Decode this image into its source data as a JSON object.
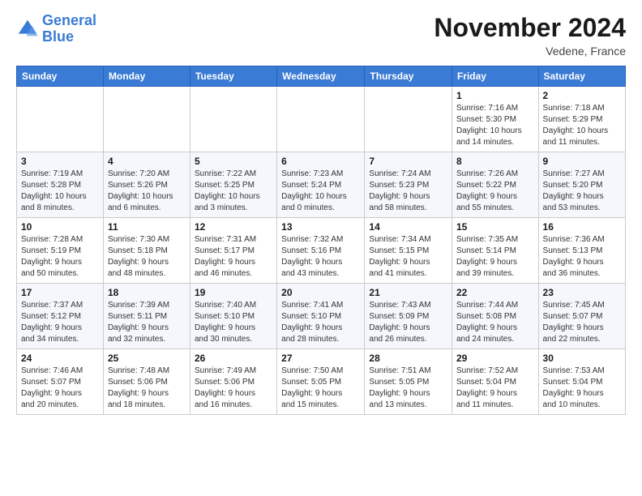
{
  "header": {
    "logo_line1": "General",
    "logo_line2": "Blue",
    "main_title": "November 2024",
    "subtitle": "Vedene, France"
  },
  "weekdays": [
    "Sunday",
    "Monday",
    "Tuesday",
    "Wednesday",
    "Thursday",
    "Friday",
    "Saturday"
  ],
  "weeks": [
    [
      {
        "day": "",
        "info": ""
      },
      {
        "day": "",
        "info": ""
      },
      {
        "day": "",
        "info": ""
      },
      {
        "day": "",
        "info": ""
      },
      {
        "day": "",
        "info": ""
      },
      {
        "day": "1",
        "info": "Sunrise: 7:16 AM\nSunset: 5:30 PM\nDaylight: 10 hours\nand 14 minutes."
      },
      {
        "day": "2",
        "info": "Sunrise: 7:18 AM\nSunset: 5:29 PM\nDaylight: 10 hours\nand 11 minutes."
      }
    ],
    [
      {
        "day": "3",
        "info": "Sunrise: 7:19 AM\nSunset: 5:28 PM\nDaylight: 10 hours\nand 8 minutes."
      },
      {
        "day": "4",
        "info": "Sunrise: 7:20 AM\nSunset: 5:26 PM\nDaylight: 10 hours\nand 6 minutes."
      },
      {
        "day": "5",
        "info": "Sunrise: 7:22 AM\nSunset: 5:25 PM\nDaylight: 10 hours\nand 3 minutes."
      },
      {
        "day": "6",
        "info": "Sunrise: 7:23 AM\nSunset: 5:24 PM\nDaylight: 10 hours\nand 0 minutes."
      },
      {
        "day": "7",
        "info": "Sunrise: 7:24 AM\nSunset: 5:23 PM\nDaylight: 9 hours\nand 58 minutes."
      },
      {
        "day": "8",
        "info": "Sunrise: 7:26 AM\nSunset: 5:22 PM\nDaylight: 9 hours\nand 55 minutes."
      },
      {
        "day": "9",
        "info": "Sunrise: 7:27 AM\nSunset: 5:20 PM\nDaylight: 9 hours\nand 53 minutes."
      }
    ],
    [
      {
        "day": "10",
        "info": "Sunrise: 7:28 AM\nSunset: 5:19 PM\nDaylight: 9 hours\nand 50 minutes."
      },
      {
        "day": "11",
        "info": "Sunrise: 7:30 AM\nSunset: 5:18 PM\nDaylight: 9 hours\nand 48 minutes."
      },
      {
        "day": "12",
        "info": "Sunrise: 7:31 AM\nSunset: 5:17 PM\nDaylight: 9 hours\nand 46 minutes."
      },
      {
        "day": "13",
        "info": "Sunrise: 7:32 AM\nSunset: 5:16 PM\nDaylight: 9 hours\nand 43 minutes."
      },
      {
        "day": "14",
        "info": "Sunrise: 7:34 AM\nSunset: 5:15 PM\nDaylight: 9 hours\nand 41 minutes."
      },
      {
        "day": "15",
        "info": "Sunrise: 7:35 AM\nSunset: 5:14 PM\nDaylight: 9 hours\nand 39 minutes."
      },
      {
        "day": "16",
        "info": "Sunrise: 7:36 AM\nSunset: 5:13 PM\nDaylight: 9 hours\nand 36 minutes."
      }
    ],
    [
      {
        "day": "17",
        "info": "Sunrise: 7:37 AM\nSunset: 5:12 PM\nDaylight: 9 hours\nand 34 minutes."
      },
      {
        "day": "18",
        "info": "Sunrise: 7:39 AM\nSunset: 5:11 PM\nDaylight: 9 hours\nand 32 minutes."
      },
      {
        "day": "19",
        "info": "Sunrise: 7:40 AM\nSunset: 5:10 PM\nDaylight: 9 hours\nand 30 minutes."
      },
      {
        "day": "20",
        "info": "Sunrise: 7:41 AM\nSunset: 5:10 PM\nDaylight: 9 hours\nand 28 minutes."
      },
      {
        "day": "21",
        "info": "Sunrise: 7:43 AM\nSunset: 5:09 PM\nDaylight: 9 hours\nand 26 minutes."
      },
      {
        "day": "22",
        "info": "Sunrise: 7:44 AM\nSunset: 5:08 PM\nDaylight: 9 hours\nand 24 minutes."
      },
      {
        "day": "23",
        "info": "Sunrise: 7:45 AM\nSunset: 5:07 PM\nDaylight: 9 hours\nand 22 minutes."
      }
    ],
    [
      {
        "day": "24",
        "info": "Sunrise: 7:46 AM\nSunset: 5:07 PM\nDaylight: 9 hours\nand 20 minutes."
      },
      {
        "day": "25",
        "info": "Sunrise: 7:48 AM\nSunset: 5:06 PM\nDaylight: 9 hours\nand 18 minutes."
      },
      {
        "day": "26",
        "info": "Sunrise: 7:49 AM\nSunset: 5:06 PM\nDaylight: 9 hours\nand 16 minutes."
      },
      {
        "day": "27",
        "info": "Sunrise: 7:50 AM\nSunset: 5:05 PM\nDaylight: 9 hours\nand 15 minutes."
      },
      {
        "day": "28",
        "info": "Sunrise: 7:51 AM\nSunset: 5:05 PM\nDaylight: 9 hours\nand 13 minutes."
      },
      {
        "day": "29",
        "info": "Sunrise: 7:52 AM\nSunset: 5:04 PM\nDaylight: 9 hours\nand 11 minutes."
      },
      {
        "day": "30",
        "info": "Sunrise: 7:53 AM\nSunset: 5:04 PM\nDaylight: 9 hours\nand 10 minutes."
      }
    ]
  ]
}
